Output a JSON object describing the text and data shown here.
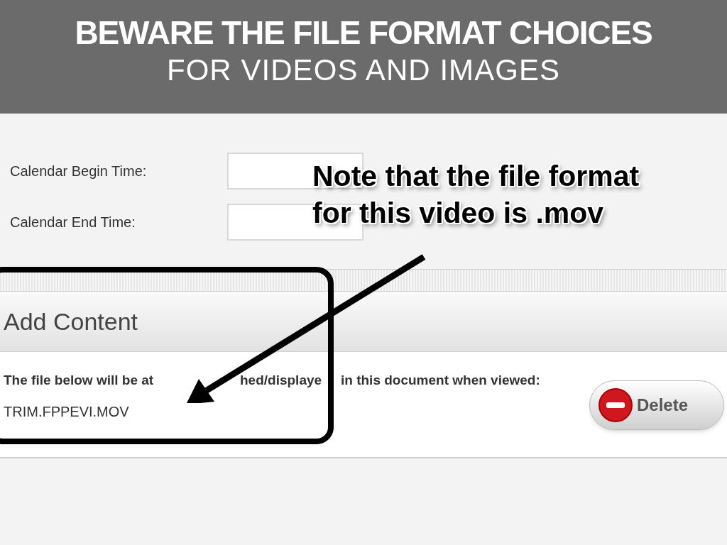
{
  "slide": {
    "title": "BEWARE THE FILE FORMAT CHOICES",
    "subtitle": "FOR VIDEOS AND IMAGES"
  },
  "form": {
    "fields": [
      {
        "label": "Calendar Begin Time:"
      },
      {
        "label": "Calendar End Time:"
      }
    ]
  },
  "callout": {
    "lines": [
      "Note that the file format",
      "for this video is .mov"
    ]
  },
  "add_content": {
    "heading": "Add Content",
    "message_parts": [
      "The file below will be at",
      "hed/displaye",
      "in this document when viewed:"
    ],
    "file_name": "TRIM.FPPEVI.MOV",
    "delete_button": "Delete"
  }
}
